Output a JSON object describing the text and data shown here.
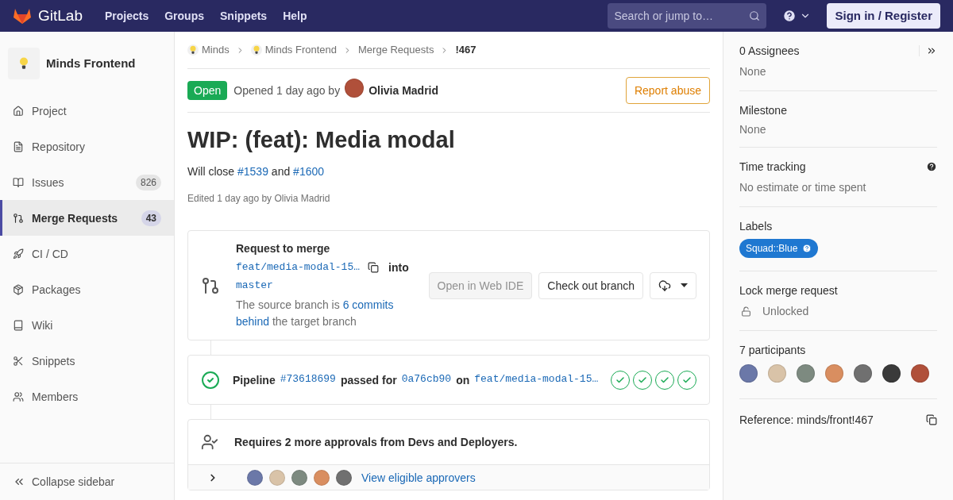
{
  "navbar": {
    "brand": "GitLab",
    "links": [
      "Projects",
      "Groups",
      "Snippets",
      "Help"
    ],
    "search": {
      "placeholder": "Search or jump to…"
    },
    "sign_in": "Sign in / Register"
  },
  "sidebar": {
    "project": "Minds Frontend",
    "items": [
      {
        "label": "Project",
        "selected": false
      },
      {
        "label": "Repository",
        "selected": false
      },
      {
        "label": "Issues",
        "count": "826",
        "selected": false
      },
      {
        "label": "Merge Requests",
        "count": "43",
        "selected": true
      },
      {
        "label": "CI / CD",
        "selected": false
      },
      {
        "label": "Packages",
        "selected": false
      },
      {
        "label": "Wiki",
        "selected": false
      },
      {
        "label": "Snippets",
        "selected": false
      },
      {
        "label": "Members",
        "selected": false
      }
    ],
    "collapse": "Collapse sidebar"
  },
  "breadcrumb": [
    {
      "label": "Minds",
      "kind": "group"
    },
    {
      "label": "Minds Frontend",
      "kind": "group"
    },
    {
      "label": "Merge Requests",
      "kind": "plain"
    },
    {
      "label": "!467",
      "kind": "current"
    }
  ],
  "header": {
    "status": "Open",
    "opened": "Opened 1 day ago by",
    "author": "Olivia Madrid",
    "report": "Report abuse"
  },
  "title": "WIP: (feat): Media modal",
  "description": [
    {
      "kind": "text",
      "text": "Will close "
    },
    {
      "kind": "link",
      "text": "#1539"
    },
    {
      "kind": "text",
      "text": " and "
    },
    {
      "kind": "link",
      "text": "#1600"
    }
  ],
  "edited": "Edited 1 day ago by Olivia Madrid",
  "merge_widget": {
    "title": "Request to merge",
    "source": "feat/media-modal-15…",
    "into": "into",
    "target": "master",
    "behind": [
      {
        "kind": "text",
        "text": "The source branch is "
      },
      {
        "kind": "link",
        "text": "6 commits"
      },
      {
        "kind": "link",
        "text": "behind"
      },
      {
        "kind": "text",
        "text": " the target branch"
      }
    ],
    "web_ide": "Open in Web IDE",
    "checkout": "Check out branch"
  },
  "pipeline": {
    "parts": [
      {
        "kind": "bold",
        "text": "Pipeline"
      },
      {
        "kind": "code",
        "text": "#73618699"
      },
      {
        "kind": "bold",
        "text": "passed for"
      },
      {
        "kind": "code",
        "text": "0a76cb90"
      },
      {
        "kind": "bold",
        "text": "on"
      },
      {
        "kind": "code",
        "text": "feat/media-modal-15…"
      }
    ],
    "stages": [
      {
        "passed": true
      },
      {
        "passed": true
      },
      {
        "passed": true
      },
      {
        "passed": true
      }
    ]
  },
  "approvals": {
    "message": "Requires 2 more approvals from Devs and Deployers.",
    "approvers": [
      {
        "color": "#6b78a8"
      },
      {
        "color": "#d9c3a8"
      },
      {
        "color": "#7d8a80"
      },
      {
        "color": "#d98e60"
      },
      {
        "color": "#707070"
      }
    ],
    "view": "View eligible approvers"
  },
  "right_sidebar": {
    "assignees": {
      "label": "0 Assignees",
      "value": "None"
    },
    "milestone": {
      "label": "Milestone",
      "value": "None"
    },
    "time_tracking": {
      "label": "Time tracking",
      "value": "No estimate or time spent"
    },
    "labels": {
      "label": "Labels",
      "tags": [
        {
          "text": "Squad::Blue",
          "color": "#1f78d1"
        }
      ]
    },
    "lock": {
      "label": "Lock merge request",
      "value": "Unlocked"
    },
    "participants": {
      "label": "7 participants",
      "avatars": [
        {
          "color": "#6b78a8"
        },
        {
          "color": "#d9c3a8"
        },
        {
          "color": "#7d8a80"
        },
        {
          "color": "#d98e60"
        },
        {
          "color": "#707070"
        },
        {
          "color": "#3a3a3a"
        },
        {
          "color": "#b0503a"
        }
      ]
    },
    "reference": "Reference: minds/front!467"
  }
}
